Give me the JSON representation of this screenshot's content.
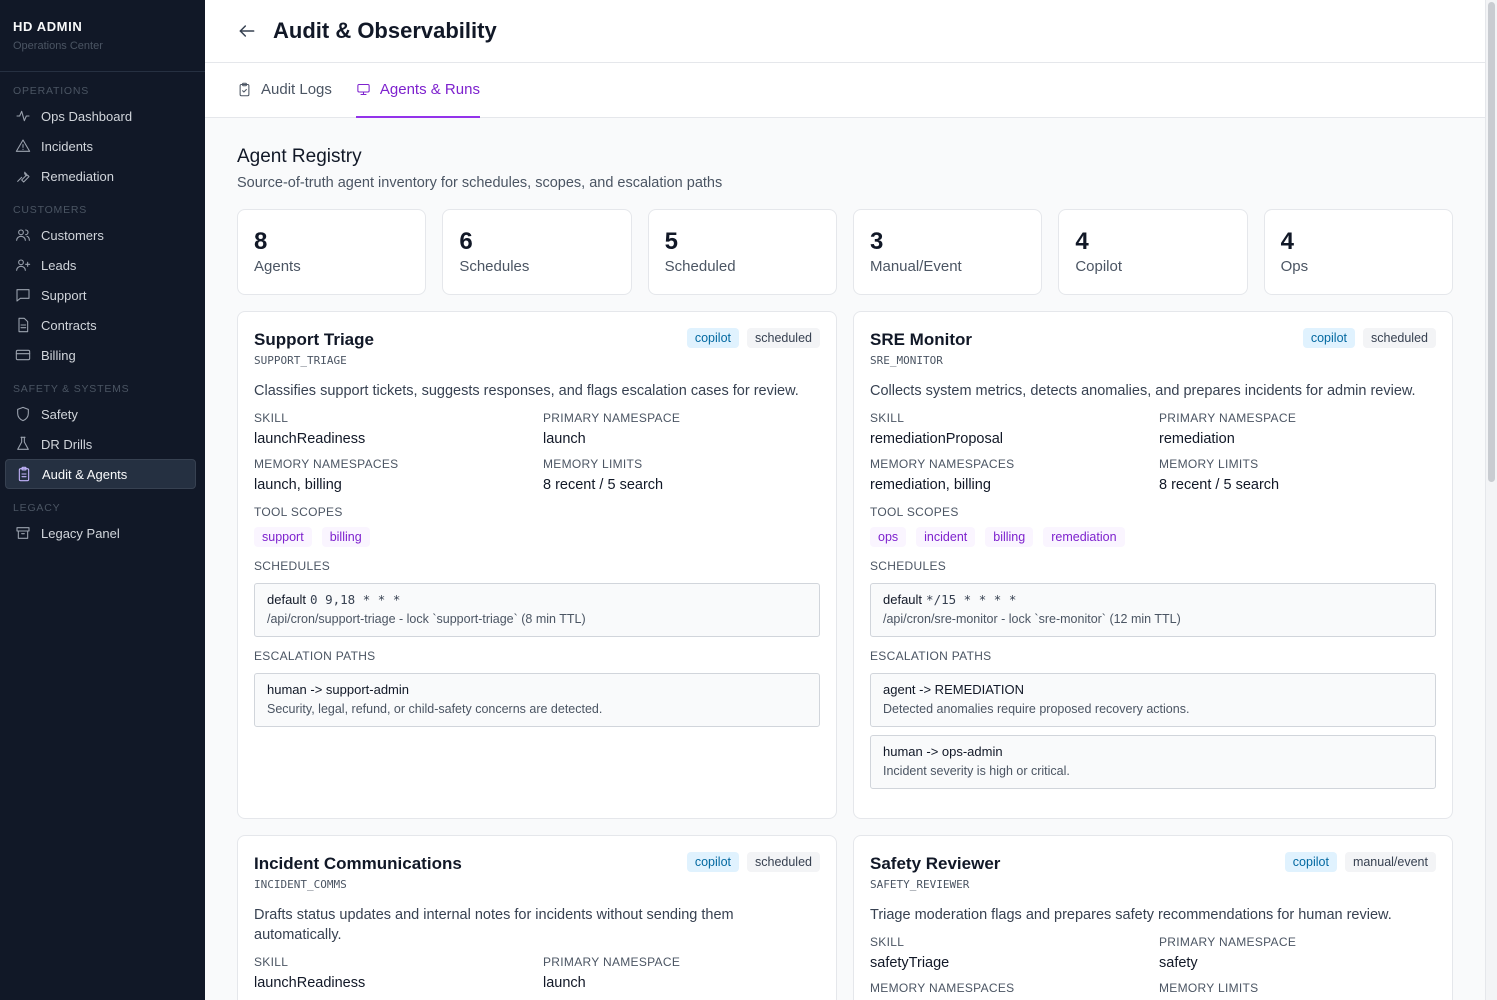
{
  "brand": {
    "title": "HD ADMIN",
    "subtitle": "Operations Center"
  },
  "sidebar": {
    "sections": [
      {
        "label": "OPERATIONS",
        "items": [
          {
            "label": "Ops Dashboard",
            "icon": "activity-icon"
          },
          {
            "label": "Incidents",
            "icon": "alert-triangle-icon"
          },
          {
            "label": "Remediation",
            "icon": "wrench-icon"
          }
        ]
      },
      {
        "label": "CUSTOMERS",
        "items": [
          {
            "label": "Customers",
            "icon": "users-icon"
          },
          {
            "label": "Leads",
            "icon": "user-plus-icon"
          },
          {
            "label": "Support",
            "icon": "message-square-icon"
          },
          {
            "label": "Contracts",
            "icon": "file-text-icon"
          },
          {
            "label": "Billing",
            "icon": "credit-card-icon"
          }
        ]
      },
      {
        "label": "SAFETY & SYSTEMS",
        "items": [
          {
            "label": "Safety",
            "icon": "shield-icon"
          },
          {
            "label": "DR Drills",
            "icon": "flask-icon"
          },
          {
            "label": "Audit & Agents",
            "icon": "clipboard-icon",
            "active": true
          }
        ]
      },
      {
        "label": "LEGACY",
        "items": [
          {
            "label": "Legacy Panel",
            "icon": "archive-icon"
          }
        ]
      }
    ]
  },
  "header": {
    "title": "Audit & Observability"
  },
  "tabs": [
    {
      "label": "Audit Logs",
      "icon": "clipboard-check-icon",
      "active": false
    },
    {
      "label": "Agents & Runs",
      "icon": "monitor-icon",
      "active": true
    }
  ],
  "registry": {
    "title": "Agent Registry",
    "subtitle": "Source-of-truth agent inventory for schedules, scopes, and escalation paths"
  },
  "stats": [
    {
      "value": "8",
      "label": "Agents"
    },
    {
      "value": "6",
      "label": "Schedules"
    },
    {
      "value": "5",
      "label": "Scheduled"
    },
    {
      "value": "3",
      "label": "Manual/Event"
    },
    {
      "value": "4",
      "label": "Copilot"
    },
    {
      "value": "4",
      "label": "Ops"
    }
  ],
  "labels": {
    "skill": "SKILL",
    "primary_namespace": "PRIMARY NAMESPACE",
    "memory_namespaces": "MEMORY NAMESPACES",
    "memory_limits": "MEMORY LIMITS",
    "tool_scopes": "TOOL SCOPES",
    "schedules": "SCHEDULES",
    "escalation_paths": "ESCALATION PATHS"
  },
  "agents": [
    {
      "name": "Support Triage",
      "code": "SUPPORT_TRIAGE",
      "badges": [
        "copilot",
        "scheduled"
      ],
      "description": "Classifies support tickets, suggests responses, and flags escalation cases for review.",
      "skill": "launchReadiness",
      "primary_namespace": "launch",
      "memory_namespaces": "launch, billing",
      "memory_limits": "8 recent / 5 search",
      "tool_scopes": [
        "support",
        "billing"
      ],
      "schedules": [
        {
          "name": "default",
          "cron": "0 9,18 * * *",
          "detail": "/api/cron/support-triage - lock `support-triage` (8 min TTL)"
        }
      ],
      "escalations": [
        {
          "route": "human -> support-admin",
          "detail": "Security, legal, refund, or child-safety concerns are detected."
        }
      ]
    },
    {
      "name": "SRE Monitor",
      "code": "SRE_MONITOR",
      "badges": [
        "copilot",
        "scheduled"
      ],
      "description": "Collects system metrics, detects anomalies, and prepares incidents for admin review.",
      "skill": "remediationProposal",
      "primary_namespace": "remediation",
      "memory_namespaces": "remediation, billing",
      "memory_limits": "8 recent / 5 search",
      "tool_scopes": [
        "ops",
        "incident",
        "billing",
        "remediation"
      ],
      "schedules": [
        {
          "name": "default",
          "cron": "*/15 * * * *",
          "detail": "/api/cron/sre-monitor - lock `sre-monitor` (12 min TTL)"
        }
      ],
      "escalations": [
        {
          "route": "agent -> REMEDIATION",
          "detail": "Detected anomalies require proposed recovery actions."
        },
        {
          "route": "human -> ops-admin",
          "detail": "Incident severity is high or critical."
        }
      ]
    },
    {
      "name": "Incident Communications",
      "code": "INCIDENT_COMMS",
      "badges": [
        "copilot",
        "scheduled"
      ],
      "description": "Drafts status updates and internal notes for incidents without sending them automatically.",
      "skill": "launchReadiness",
      "primary_namespace": "launch"
    },
    {
      "name": "Safety Reviewer",
      "code": "SAFETY_REVIEWER",
      "badges": [
        "copilot",
        "manual/event"
      ],
      "description": "Triage moderation flags and prepares safety recommendations for human review.",
      "skill": "safetyTriage",
      "primary_namespace": "safety"
    }
  ]
}
